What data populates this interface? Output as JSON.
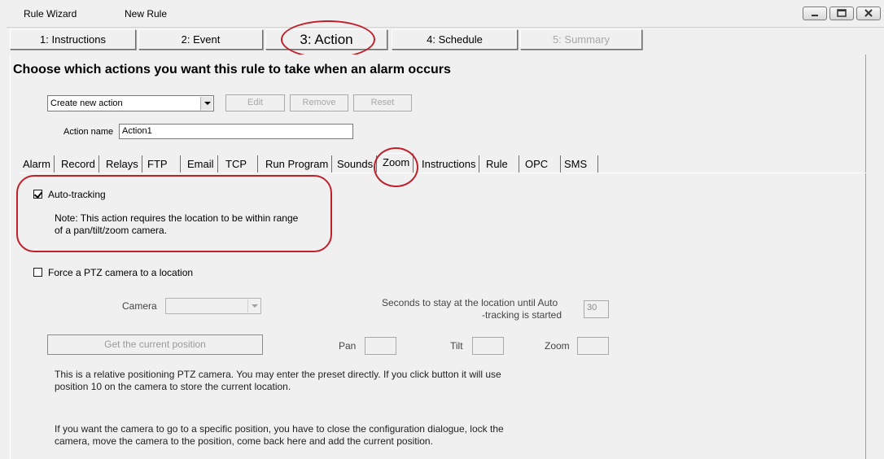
{
  "window": {
    "title_left": "Rule Wizard",
    "title_right": "New Rule"
  },
  "steps": [
    {
      "label": "1: Instructions",
      "state": "normal"
    },
    {
      "label": "2: Event",
      "state": "normal"
    },
    {
      "label": "3: Action",
      "state": "active"
    },
    {
      "label": "4: Schedule",
      "state": "normal"
    },
    {
      "label": "5: Summary",
      "state": "disabled"
    }
  ],
  "heading": "Choose which actions you want this rule to take when an alarm occurs",
  "action_select": {
    "value": "Create new action"
  },
  "buttons": {
    "edit": "Edit",
    "remove": "Remove",
    "reset": "Reset"
  },
  "action_name": {
    "label": "Action name",
    "value": "Action1"
  },
  "tabs": [
    "Alarm",
    "Record",
    "Relays",
    "FTP",
    "Email",
    "TCP",
    "Run Program",
    "Sounds",
    "Zoom",
    "Instructions",
    "Rule",
    "OPC",
    "SMS"
  ],
  "active_tab": "Zoom",
  "auto_tracking": {
    "label": "Auto-tracking",
    "checked": true,
    "note_line1": "Note: This action requires the location to be within range",
    "note_line2": "of a pan/tilt/zoom camera."
  },
  "force_ptz": {
    "label": "Force a PTZ camera to a location",
    "checked": false
  },
  "camera": {
    "label": "Camera",
    "value": ""
  },
  "seconds": {
    "label_line1": "Seconds to stay at the location until Auto",
    "label_line2": "-tracking is started",
    "value": "30"
  },
  "get_position_button": "Get the current position",
  "pan": {
    "label": "Pan",
    "value": ""
  },
  "tilt": {
    "label": "Tilt",
    "value": ""
  },
  "zoom": {
    "label": "Zoom",
    "value": ""
  },
  "info1_line1": "This is a relative positioning PTZ camera.  You may enter the preset directly.  If you click button it will use",
  "info1_line2": "position 10 on the camera to store the current location.",
  "info2_line1": "If you want the camera to go to a specific position, you have to close the configuration dialogue, lock the",
  "info2_line2": "camera, move the camera to the position, come back here and add the current position.",
  "annotation_color": "#c0202a"
}
